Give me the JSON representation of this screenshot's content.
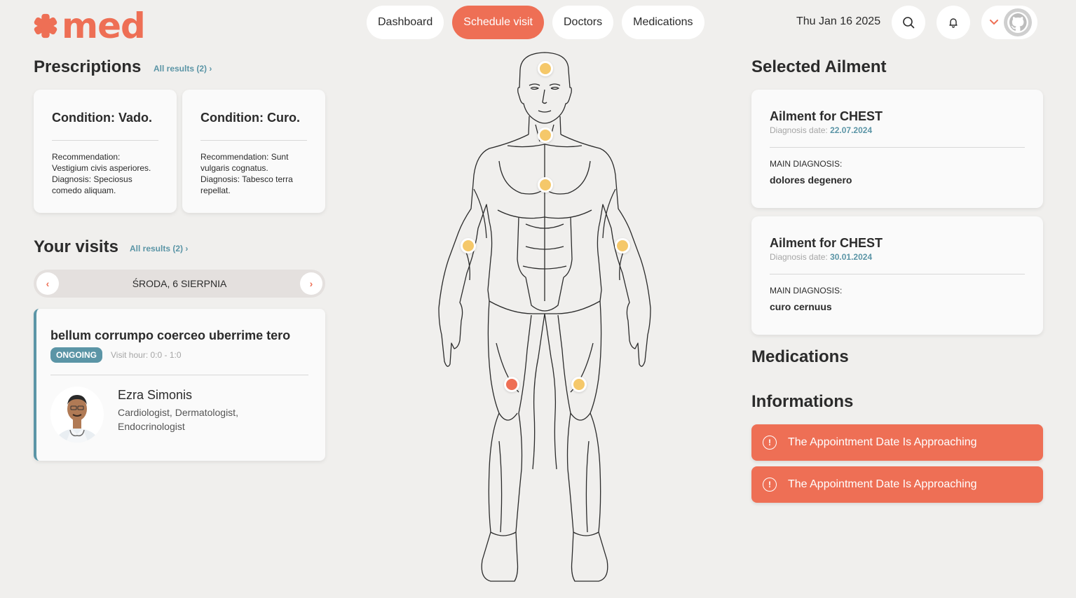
{
  "app": {
    "logo_text": "med"
  },
  "nav": {
    "items": [
      {
        "label": "Dashboard",
        "active": false
      },
      {
        "label": "Schedule visit",
        "active": true
      },
      {
        "label": "Doctors",
        "active": false
      },
      {
        "label": "Medications",
        "active": false
      }
    ]
  },
  "header": {
    "date": "Thu Jan 16 2025"
  },
  "prescriptions": {
    "title": "Prescriptions",
    "all_link": "All results (2) ›",
    "cards": [
      {
        "title": "Condition: Vado.",
        "body": "Recommendation: Vestigium civis asperiores. Diagnosis: Speciosus comedo aliquam."
      },
      {
        "title": "Condition: Curo.",
        "body": "Recommendation: Sunt vulgaris cognatus. Diagnosis: Tabesco terra repellat."
      }
    ]
  },
  "visits": {
    "title": "Your visits",
    "all_link": "All results (2) ›",
    "date_label": "ŚRODA, 6 SIERPNIA",
    "prev": "‹",
    "next": "›",
    "card": {
      "title": "bellum corrumpo coerceo uberrime tero",
      "status": "ONGOING",
      "hour": "Visit hour: 0:0 - 1:0",
      "doctor_name": "Ezra Simonis",
      "doctor_spec": "Cardiologist, Dermatologist, Endocrinologist"
    }
  },
  "ailment": {
    "title": "Selected Ailment",
    "cards": [
      {
        "title": "Ailment for CHEST",
        "date_label": "Diagnosis date:",
        "date": "22.07.2024",
        "main_label": "MAIN DIAGNOSIS:",
        "main": "dolores degenero"
      },
      {
        "title": "Ailment for CHEST",
        "date_label": "Diagnosis date:",
        "date": "30.01.2024",
        "main_label": "MAIN DIAGNOSIS:",
        "main": "curo cernuus"
      }
    ]
  },
  "medications": {
    "title": "Medications"
  },
  "informations": {
    "title": "Informations",
    "items": [
      "The Appointment Date Is Approaching",
      "The Appointment Date Is Approaching"
    ]
  },
  "colors": {
    "accent": "#ee6f55",
    "teal": "#5b95a6",
    "dot": "#f5c86a",
    "bg": "#f0efed"
  },
  "icons": [
    "asterisk-logo-icon",
    "search-icon",
    "bell-icon",
    "chevron-down-icon",
    "github-avatar-icon",
    "chevron-left-icon",
    "chevron-right-icon",
    "alert-circle-icon"
  ]
}
